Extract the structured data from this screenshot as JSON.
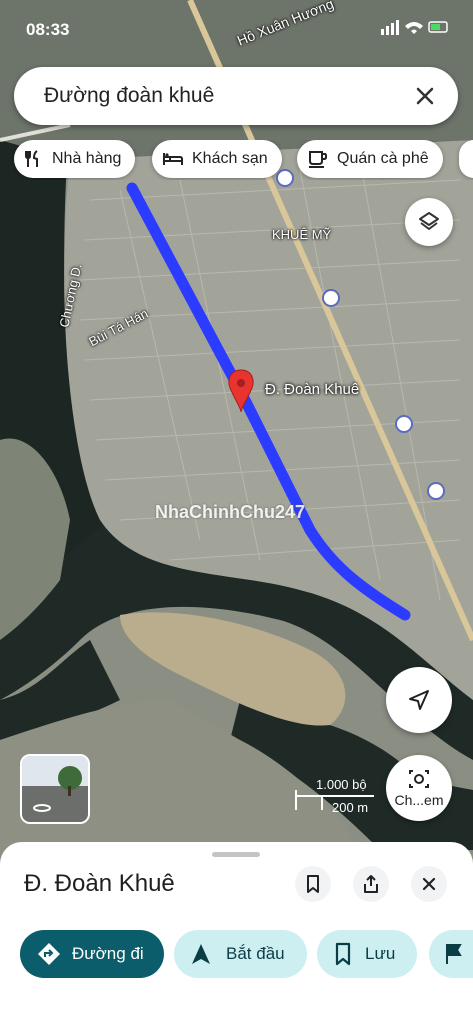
{
  "status_bar": {
    "time": "08:33"
  },
  "search": {
    "query": "Đường đoàn khuê"
  },
  "chips": [
    {
      "label": "Nhà hàng",
      "icon": "restaurant-icon"
    },
    {
      "label": "Khách sạn",
      "icon": "hotel-icon"
    },
    {
      "label": "Quán cà phê",
      "icon": "coffee-icon"
    }
  ],
  "map": {
    "labels": {
      "ho_xuan_huong": "Hồ Xuân Hương",
      "khue_my": "KHUÊ MỸ",
      "chuong_d": "Chương D.",
      "bui_ta_han": "Bùi Tá Hán"
    },
    "pin_label": "Đ. Đoàn Khuê",
    "watermark": "NhaChinhChu247",
    "scale": {
      "imperial": "1.000 bộ",
      "metric": "200 m"
    },
    "streetview_label": "Ch...em",
    "route_color": "#2b3bff",
    "pin_color": "#e8332f"
  },
  "place": {
    "title": "Đ. Đoàn Khuê",
    "actions": [
      {
        "label": "Đường đi",
        "icon": "directions-icon"
      },
      {
        "label": "Bắt đầu",
        "icon": "navigate-icon"
      },
      {
        "label": "Lưu",
        "icon": "bookmark-icon"
      }
    ]
  }
}
